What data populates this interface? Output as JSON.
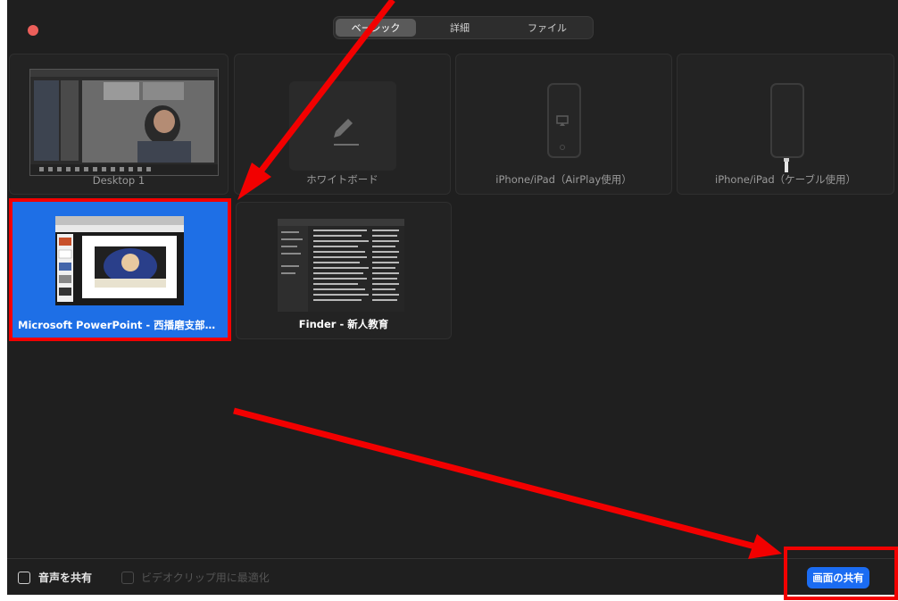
{
  "tabs": [
    {
      "label": "ベーシック",
      "active": true
    },
    {
      "label": "詳細",
      "active": false
    },
    {
      "label": "ファイル",
      "active": false
    }
  ],
  "share_items": [
    {
      "label": "Desktop 1"
    },
    {
      "label": "ホワイトボード"
    },
    {
      "label": "iPhone/iPad（AirPlay使用）"
    },
    {
      "label": "iPhone/iPad（ケーブル使用）"
    },
    {
      "label": "Microsoft PowerPoint - 西播磨支部…",
      "selected": true
    },
    {
      "label": "Finder - 新人教育"
    }
  ],
  "footer": {
    "share_audio_label": "音声を共有",
    "optimize_video_label": "ビデオクリップ用に最適化",
    "share_screen_button": "画面の共有"
  },
  "colors": {
    "accent": "#1b6cf2",
    "selected_tile": "#1e6fe6",
    "annotation_red": "#f20000",
    "close_dot": "#ec5f5a"
  }
}
